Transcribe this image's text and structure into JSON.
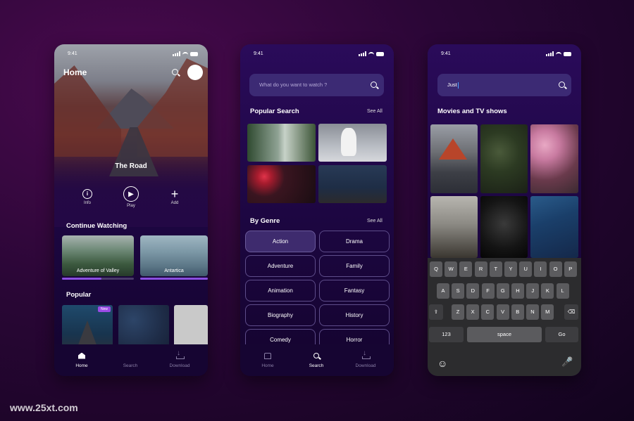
{
  "status_time": "9:41",
  "watermark": "www.25xt.com",
  "phone1": {
    "title": "Home",
    "featured_title": "The Road",
    "actions": [
      {
        "label": "Info",
        "icon": "info-icon"
      },
      {
        "label": "Play",
        "icon": "play-icon"
      },
      {
        "label": "Add",
        "icon": "plus-icon"
      }
    ],
    "continue_watching": {
      "title": "Continue Watching",
      "items": [
        {
          "label": "Adventure of Valley",
          "progress": 0.55
        },
        {
          "label": "Antartica",
          "progress": 1.0
        }
      ]
    },
    "popular": {
      "title": "Popular",
      "badge": "New"
    }
  },
  "tabs": [
    {
      "label": "Home",
      "icon": "home-icon"
    },
    {
      "label": "Search",
      "icon": "search-icon"
    },
    {
      "label": "Download",
      "icon": "download-icon"
    }
  ],
  "phone2": {
    "search_placeholder": "What do you want to watch ?",
    "popular_search": {
      "title": "Popular Search",
      "see_all": "See All"
    },
    "by_genre": {
      "title": "By Genre",
      "see_all": "See All",
      "genres": [
        "Action",
        "Drama",
        "Adventure",
        "Family",
        "Animation",
        "Fantasy",
        "Biography",
        "History",
        "Comedy",
        "Horror"
      ],
      "selected": "Action"
    }
  },
  "phone3": {
    "search_value": "Just",
    "results_title": "Movies and TV shows",
    "keyboard": {
      "row1": [
        "Q",
        "W",
        "E",
        "R",
        "T",
        "Y",
        "U",
        "I",
        "O",
        "P"
      ],
      "row2": [
        "A",
        "S",
        "D",
        "F",
        "G",
        "H",
        "J",
        "K",
        "L"
      ],
      "row3": [
        "Z",
        "X",
        "C",
        "V",
        "B",
        "N",
        "M"
      ],
      "numbers_key": "123",
      "space_key": "space",
      "go_key": "Go"
    }
  }
}
